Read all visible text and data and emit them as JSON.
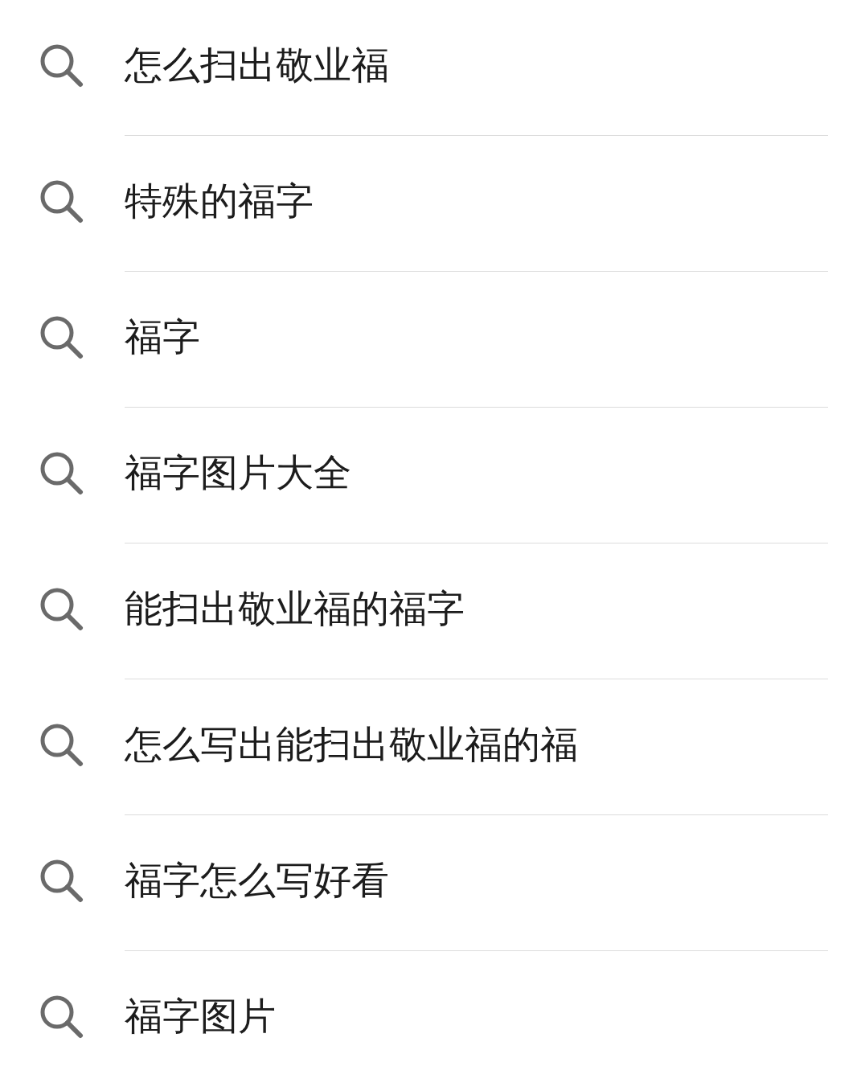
{
  "suggestions": [
    {
      "text": "怎么扫出敬业福"
    },
    {
      "text": "特殊的福字"
    },
    {
      "text": "福字"
    },
    {
      "text": "福字图片大全"
    },
    {
      "text": "能扫出敬业福的福字"
    },
    {
      "text": "怎么写出能扫出敬业福的福"
    },
    {
      "text": "福字怎么写好看"
    },
    {
      "text": "福字图片"
    }
  ]
}
